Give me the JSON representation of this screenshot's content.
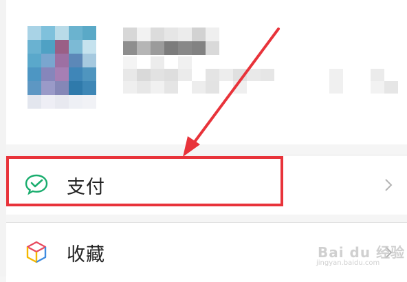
{
  "profile": {
    "avatar_label": "user-avatar (pixelated)",
    "name_label": "user-name (pixelated)",
    "id_label": "user-id (pixelated)"
  },
  "menu": {
    "items": [
      {
        "label": "支付",
        "icon": "wechat-pay-icon",
        "icon_color": "#1aad6e"
      },
      {
        "label": "收藏",
        "icon": "favorites-cube-icon"
      }
    ]
  },
  "annotation": {
    "highlight_color": "#e8333a",
    "arrow_color": "#e8333a"
  },
  "watermark": {
    "brand": "Bai du 经验",
    "url": "jingyan.baidu.com"
  }
}
